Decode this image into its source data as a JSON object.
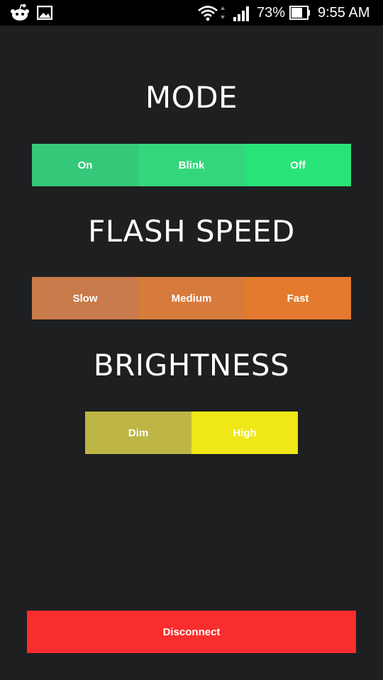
{
  "status_bar": {
    "icons": [
      "reddit-alien-icon",
      "image-icon",
      "wifi-icon",
      "cellular-signal-icon",
      "battery-icon"
    ],
    "battery_percent": "73%",
    "time": "9:55 AM"
  },
  "mode": {
    "heading": "MODE",
    "options": [
      {
        "label": "On",
        "color": "#36c97a"
      },
      {
        "label": "Blink",
        "color": "#34d67c"
      },
      {
        "label": "Off",
        "color": "#28e377"
      }
    ]
  },
  "flash_speed": {
    "heading": "FLASH SPEED",
    "options": [
      {
        "label": "Slow",
        "color": "#c97a4a"
      },
      {
        "label": "Medium",
        "color": "#d67b3c"
      },
      {
        "label": "Fast",
        "color": "#e37a2d"
      }
    ]
  },
  "brightness": {
    "heading": "BRIGHTNESS",
    "options": [
      {
        "label": "Dim",
        "color": "#bdb645"
      },
      {
        "label": "High",
        "color": "#efe716"
      }
    ]
  },
  "disconnect": {
    "label": "Disconnect",
    "color": "#f92d2d"
  }
}
